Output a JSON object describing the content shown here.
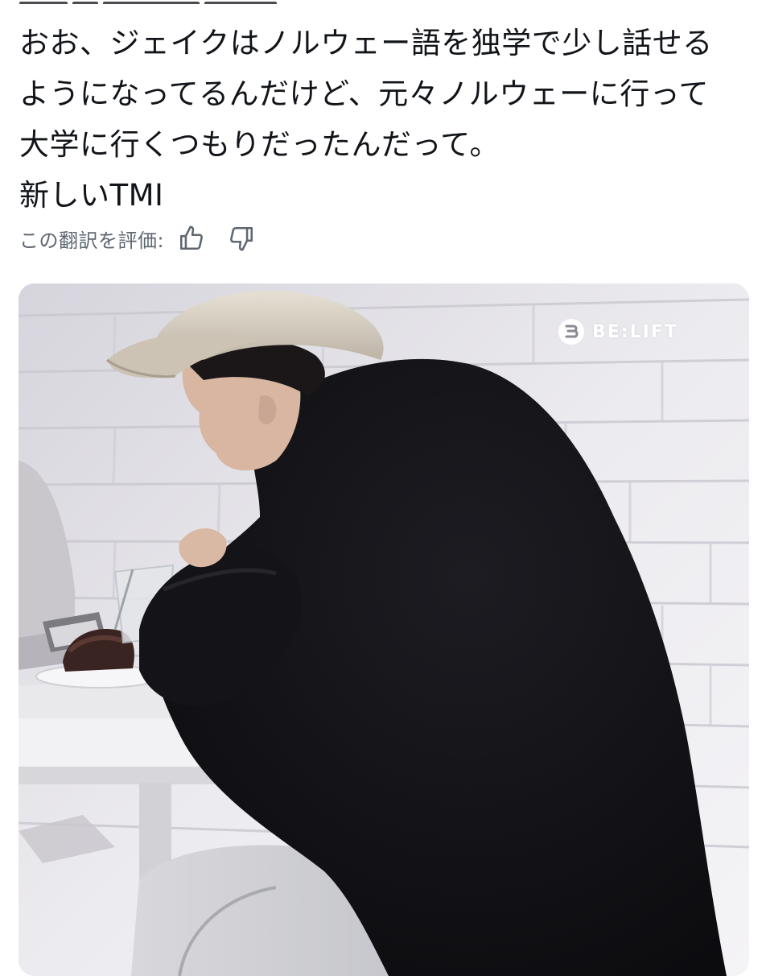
{
  "post": {
    "lines": [
      "おお、ジェイクはノルウェー語を独学で少し話せる",
      "ようになってるんだけど、元々ノルウェーに行って",
      "大学に行くつもりだったんだって。",
      "新しいTMI"
    ]
  },
  "translation_rating": {
    "label": "この翻訳を評価:",
    "thumbs_up_icon": "thumbs-up-icon",
    "thumbs_down_icon": "thumbs-down-icon"
  },
  "media": {
    "watermark_text": "BE:LIFT",
    "watermark_icon": "belift-logo"
  },
  "colors": {
    "text": "#111418",
    "secondary_text": "#5f6771",
    "background": "#ffffff"
  }
}
